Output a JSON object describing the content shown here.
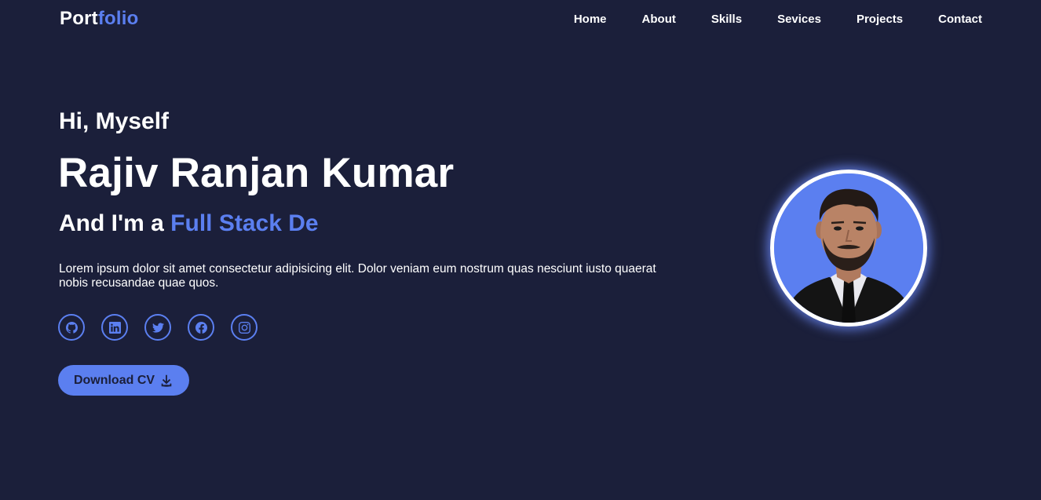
{
  "header": {
    "logo_main": "Port",
    "logo_accent": "folio",
    "nav": [
      {
        "label": "Home"
      },
      {
        "label": "About"
      },
      {
        "label": "Skills"
      },
      {
        "label": "Sevices"
      },
      {
        "label": "Projects"
      },
      {
        "label": "Contact"
      }
    ]
  },
  "hero": {
    "greeting": "Hi, Myself",
    "name": "Rajiv Ranjan Kumar",
    "role_prefix": "And I'm a",
    "role_typed": "Full Stack De",
    "description": "Lorem ipsum dolor sit amet consectetur adipisicing elit. Dolor veniam eum nostrum quas nesciunt iusto quaerat nobis recusandae quae quos.",
    "socials": [
      {
        "icon": "github-icon"
      },
      {
        "icon": "linkedin-icon"
      },
      {
        "icon": "twitter-icon"
      },
      {
        "icon": "facebook-icon"
      },
      {
        "icon": "instagram-icon"
      }
    ],
    "cv_button_label": "Download CV",
    "cv_button_icon": "download-icon"
  },
  "colors": {
    "background": "#1b1f3a",
    "accent": "#5b7ff0",
    "text": "#ffffff"
  }
}
